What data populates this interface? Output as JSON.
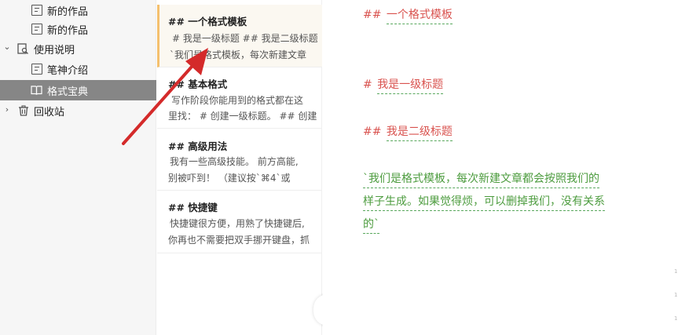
{
  "sidebar": {
    "items": [
      {
        "label": "新的作品",
        "kind": "doc"
      },
      {
        "label": "新的作品",
        "kind": "doc"
      },
      {
        "label": "使用说明",
        "kind": "folder",
        "caret": "⌄"
      },
      {
        "label": "笔神介绍",
        "kind": "doc"
      },
      {
        "label": "格式宝典",
        "kind": "book",
        "active": true
      },
      {
        "label": "回收站",
        "kind": "trash",
        "caret": "›"
      }
    ]
  },
  "articles": [
    {
      "title": "## 一个格式模板",
      "lines": [
        "# 我是一级标题 ## 我是二级标题",
        "`我们是格式模板，每次新建文章"
      ]
    },
    {
      "title": "## 基本格式",
      "lines": [
        "写作阶段你能用到的格式都在这",
        "里找： # 创建一级标题。 ## 创建"
      ]
    },
    {
      "title": "## 高级用法",
      "lines": [
        "我有一些高级技能。 前方高能,",
        "别被吓到！ （建议按`⌘4`或"
      ]
    },
    {
      "title": "## 快捷键",
      "lines": [
        "快捷键很方便，用熟了快捷键后,",
        "你再也不需要把双手挪开键盘，抓"
      ]
    }
  ],
  "collapse_icon": "‹",
  "editor": {
    "h2_mark": "##",
    "h2_text": "一个格式模板",
    "h1_mark": "#",
    "h1_text": "我是一级标题",
    "sub_mark": "##",
    "sub_text": "我是二级标题",
    "para_line1": "`我们是格式模板，每次新建文章都会按照我们的",
    "para_line2": "样子生成。如果觉得烦，可以删掉我们，没有关系",
    "para_line3": "的`"
  },
  "gutter_marks": [
    "1",
    "1",
    "1"
  ],
  "colors": {
    "accent": "#f4c06e",
    "heading": "#d9534f",
    "code": "#4d9c3f",
    "active_item": "#868686",
    "arrow": "#d42a2a"
  }
}
